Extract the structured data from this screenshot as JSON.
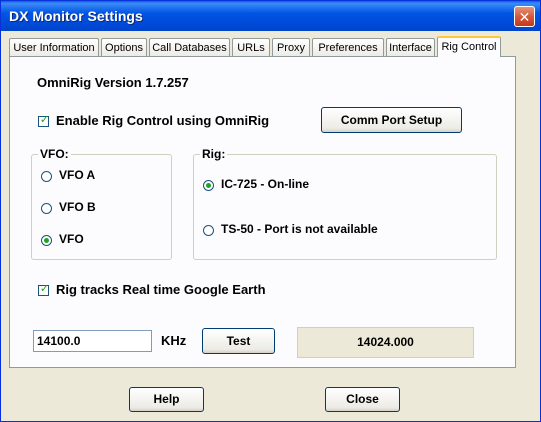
{
  "window": {
    "title": "DX Monitor Settings",
    "close_glyph": "✕"
  },
  "tabs": [
    {
      "label": "User Information"
    },
    {
      "label": "Options"
    },
    {
      "label": "Call Databases"
    },
    {
      "label": "URLs"
    },
    {
      "label": "Proxy"
    },
    {
      "label": "Preferences"
    },
    {
      "label": "Interface"
    },
    {
      "label": "Rig Control",
      "active": true
    }
  ],
  "rig_control": {
    "omnirig_version": "OmniRig  Version 1.7.257",
    "enable_label": "Enable Rig Control using OmniRig",
    "enable_checked": true,
    "comm_port_button": "Comm Port Setup",
    "vfo": {
      "title": "VFO:",
      "options": [
        {
          "label": "VFO A",
          "selected": false
        },
        {
          "label": "VFO B",
          "selected": false
        },
        {
          "label": "VFO",
          "selected": true
        }
      ]
    },
    "rig": {
      "title": "Rig:",
      "options": [
        {
          "label": "IC-725 - On-line",
          "selected": true
        },
        {
          "label": "TS-50 - Port is not available",
          "selected": false
        }
      ]
    },
    "google_earth_label": "Rig tracks Real time Google Earth",
    "google_earth_checked": true,
    "frequency_value": "14100.0",
    "frequency_unit": "KHz",
    "test_button": "Test",
    "readout_value": "14024.000"
  },
  "footer": {
    "help_button": "Help",
    "close_button": "Close"
  },
  "colors": {
    "title_bar": "#0055e5",
    "dialog_bg": "#ece9d8",
    "check_mark": "#21a121",
    "active_tab_accent": "#ffc83c"
  }
}
